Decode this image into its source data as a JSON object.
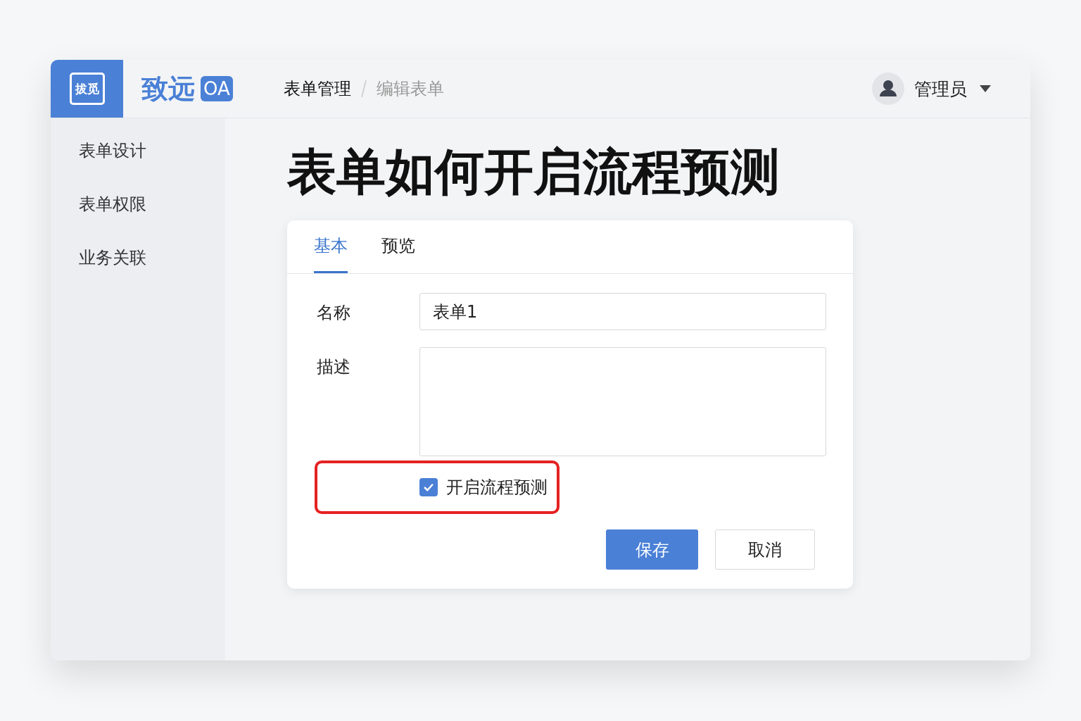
{
  "logo": {
    "badge": "拔觅",
    "name": "致远",
    "tag": "OA"
  },
  "breadcrumb": [
    {
      "label": "表单管理",
      "selected": true
    },
    {
      "label": "编辑表单",
      "selected": false
    }
  ],
  "user": {
    "name": "管理员"
  },
  "sidebar": {
    "items": [
      {
        "label": "表单设计"
      },
      {
        "label": "表单权限"
      },
      {
        "label": "业务关联"
      }
    ]
  },
  "title": "表单如何开启流程预测",
  "tabs": [
    {
      "label": "基本",
      "selected": true
    },
    {
      "label": "预览",
      "selected": false
    }
  ],
  "form": {
    "fields": [
      {
        "kind": "input",
        "label": "名称",
        "value": "表单1"
      },
      {
        "kind": "textarea",
        "label": "描述"
      }
    ],
    "checkbox": {
      "label": "开启流程预测",
      "checked": true,
      "highlighted": true
    }
  },
  "buttons": [
    {
      "label": "保存",
      "kind": "primary"
    },
    {
      "label": "取消",
      "kind": "default"
    }
  ]
}
